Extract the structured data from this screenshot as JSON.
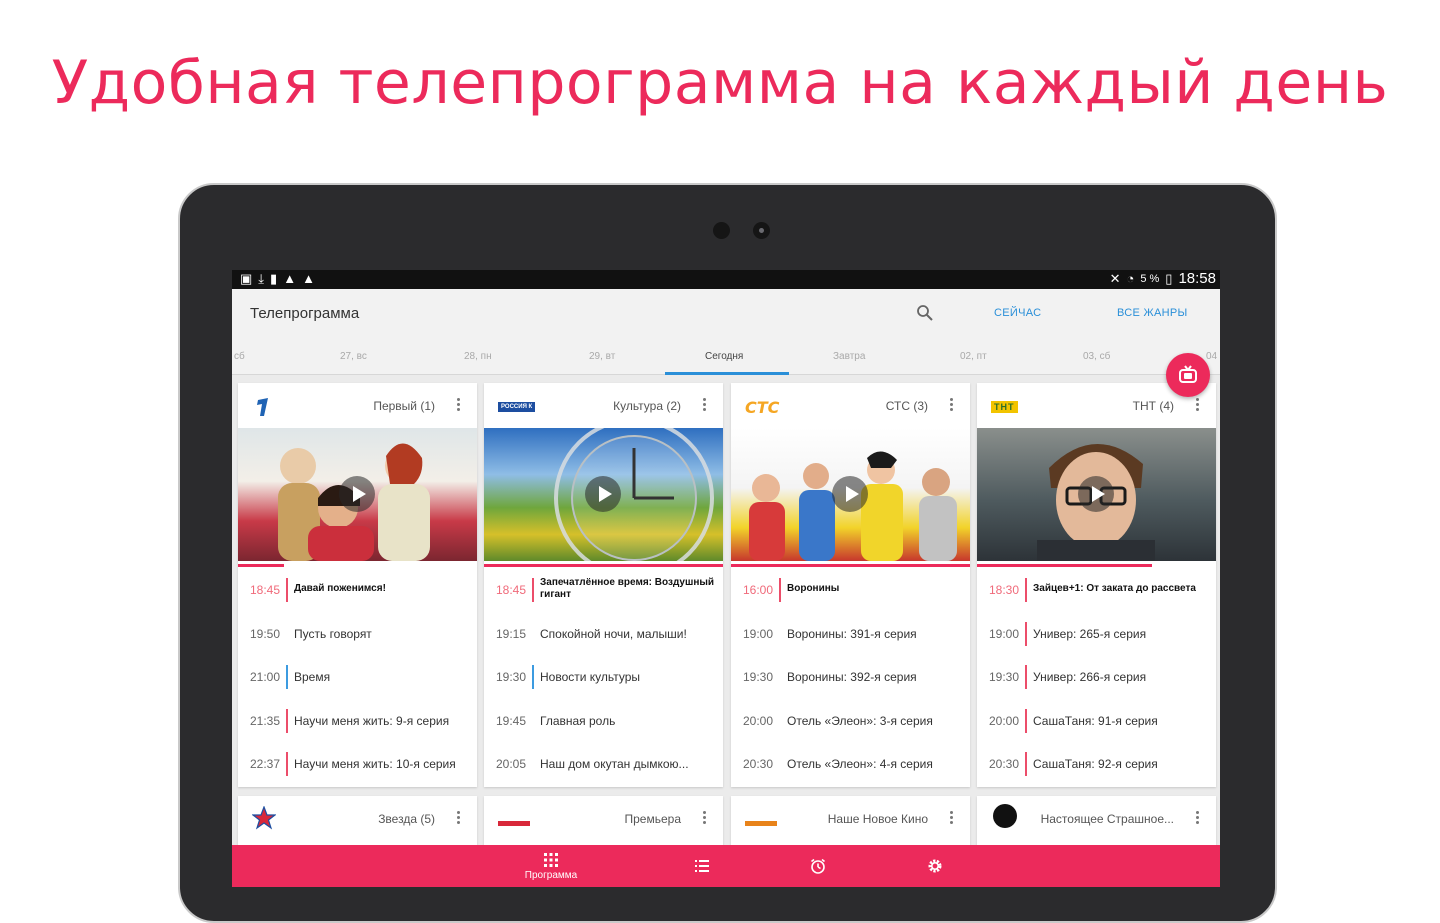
{
  "headline": "Удобная телепрограмма на каждый день",
  "status": {
    "battery": "5 %",
    "time": "18:58"
  },
  "app": {
    "title": "Телепрограмма",
    "now_label": "СЕЙЧАС",
    "genres_label": "ВСЕ ЖАНРЫ"
  },
  "days": [
    "сб",
    "27, вс",
    "28, пн",
    "29, вт",
    "Сегодня",
    "Завтра",
    "02, пт",
    "03, сб",
    "04"
  ],
  "cards": [
    {
      "channel": "Первый (1)",
      "programs": [
        {
          "time": "18:45",
          "title": "Давай поженимся!"
        },
        {
          "time": "19:50",
          "title": "Пусть говорят"
        },
        {
          "time": "21:00",
          "title": "Время"
        },
        {
          "time": "21:35",
          "title": "Научи меня жить: 9-я серия"
        },
        {
          "time": "22:37",
          "title": "Научи меня жить: 10-я серия"
        }
      ]
    },
    {
      "channel": "Культура (2)",
      "logo_text": "РОССИЯ К",
      "programs": [
        {
          "time": "18:45",
          "title": "Запечатлённое время: Воздушный гигант"
        },
        {
          "time": "19:15",
          "title": "Спокойной ночи, малыши!"
        },
        {
          "time": "19:30",
          "title": "Новости культуры"
        },
        {
          "time": "19:45",
          "title": "Главная роль"
        },
        {
          "time": "20:05",
          "title": "Наш дом окутан дымкою..."
        }
      ]
    },
    {
      "channel": "СТС (3)",
      "logo_text": "СТС",
      "programs": [
        {
          "time": "16:00",
          "title": "Воронины"
        },
        {
          "time": "19:00",
          "title": "Воронины: 391-я серия"
        },
        {
          "time": "19:30",
          "title": "Воронины: 392-я серия"
        },
        {
          "time": "20:00",
          "title": "Отель «Элеон»: 3-я серия"
        },
        {
          "time": "20:30",
          "title": "Отель «Элеон»: 4-я серия"
        }
      ]
    },
    {
      "channel": "ТНТ (4)",
      "logo_text": "ТНТ",
      "programs": [
        {
          "time": "18:30",
          "title": "Зайцев+1: От заката до рассвета"
        },
        {
          "time": "19:00",
          "title": "Универ: 265-я серия"
        },
        {
          "time": "19:30",
          "title": "Универ: 266-я серия"
        },
        {
          "time": "20:00",
          "title": "СашаТаня: 91-я серия"
        },
        {
          "time": "20:30",
          "title": "СашаТаня: 92-я серия"
        }
      ]
    }
  ],
  "small_cards": [
    "Звезда (5)",
    "Премьера",
    "Наше Новое Кино",
    "Настоящее Страшное..."
  ],
  "nav": {
    "program_label": "Программа"
  },
  "colors": {
    "accent": "#ec2a5b",
    "link": "#2a8fd8"
  }
}
